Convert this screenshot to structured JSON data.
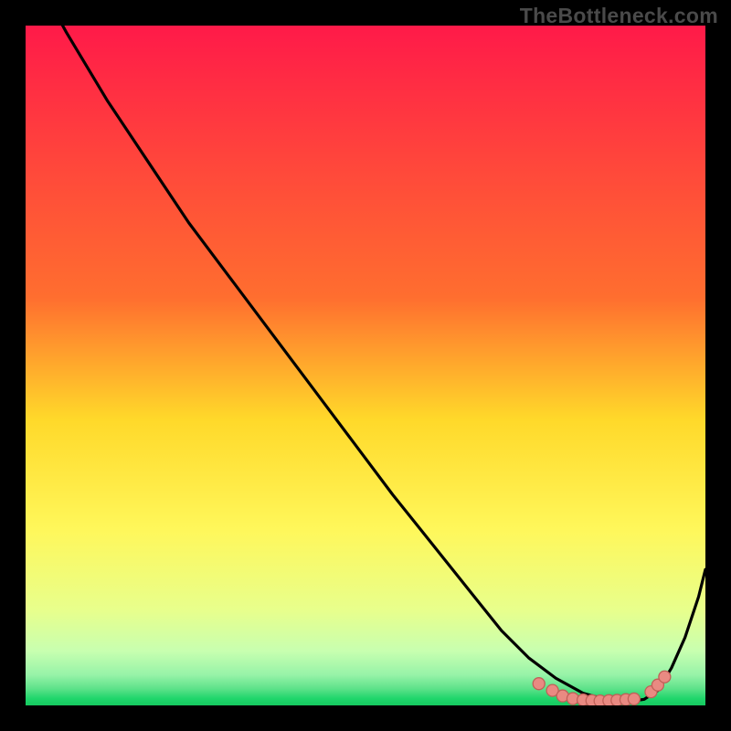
{
  "watermark": "TheBottleneck.com",
  "colors": {
    "gradient_top": "#ff1a49",
    "gradient_mid_upper": "#ff6e2f",
    "gradient_mid": "#ffd92a",
    "gradient_mid_lower": "#fff75a",
    "gradient_low": "#e8ff8c",
    "gradient_base1": "#97f3a8",
    "gradient_base2": "#1fd66b",
    "curve": "#000000",
    "dot_fill": "#e98a82",
    "dot_stroke": "#c06058",
    "frame": "#000000"
  },
  "chart_data": {
    "type": "line",
    "title": "",
    "xlabel": "",
    "ylabel": "",
    "xlim": [
      0,
      100
    ],
    "ylim": [
      0,
      100
    ],
    "series": [
      {
        "name": "curve",
        "x": [
          0,
          6,
          12,
          18,
          24,
          30,
          36,
          42,
          48,
          54,
          58,
          62,
          66,
          70,
          74,
          78,
          82,
          86,
          89,
          91,
          93,
          95,
          97,
          99,
          100
        ],
        "y": [
          110,
          99,
          89,
          80,
          71,
          63,
          55,
          47,
          39,
          31,
          26,
          21,
          16,
          11,
          7,
          4,
          1.8,
          0.7,
          0.6,
          0.9,
          2.2,
          5.5,
          10,
          16,
          20
        ]
      }
    ],
    "dots": {
      "name": "sweet-spot",
      "x": [
        75.5,
        77.5,
        79,
        80.5,
        82,
        83.3,
        84.5,
        85.8,
        87,
        88.3,
        89.5,
        92,
        93,
        94
      ],
      "y": [
        3.2,
        2.2,
        1.4,
        1.0,
        0.8,
        0.7,
        0.65,
        0.7,
        0.75,
        0.85,
        0.95,
        2.0,
        3.0,
        4.2
      ]
    }
  }
}
